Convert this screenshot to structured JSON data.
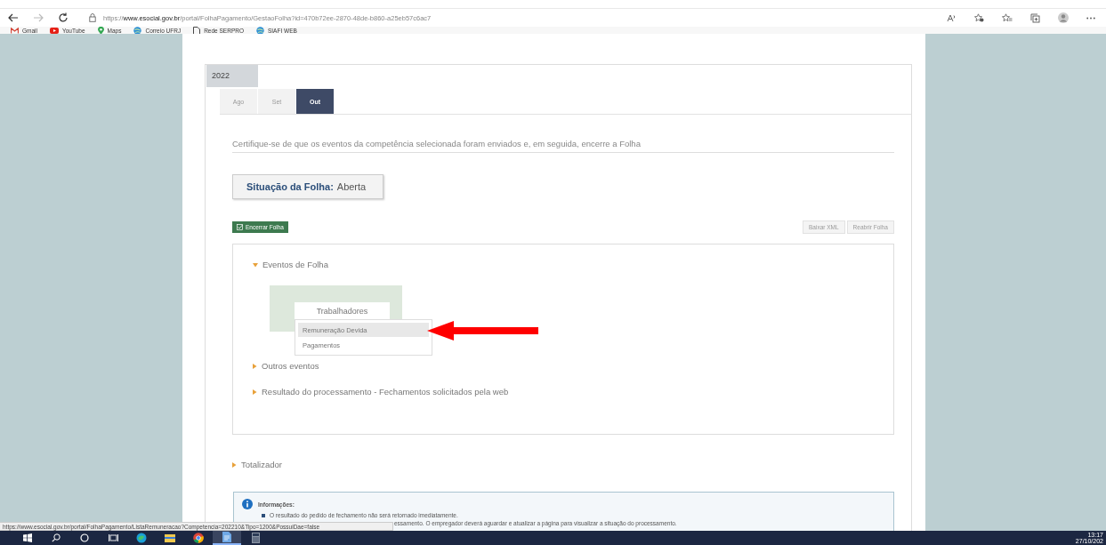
{
  "browser": {
    "url": {
      "scheme": "https://",
      "host": "www.esocial.gov.br",
      "path": "/portal/FolhaPagamento/GestaoFolha?id=470b72ee-2870-48de-b860-a25eb57c6ac7"
    },
    "bookmarks": [
      {
        "label": "Gmail",
        "kind": "gmail"
      },
      {
        "label": "YouTube",
        "kind": "youtube"
      },
      {
        "label": "Maps",
        "kind": "pin"
      },
      {
        "label": "Correio UFRJ",
        "kind": "globe"
      },
      {
        "label": "Rede SERPRO",
        "kind": "page"
      },
      {
        "label": "SIAFI WEB",
        "kind": "globe"
      }
    ]
  },
  "page": {
    "year": "2022",
    "months": [
      {
        "label": "Ago",
        "selected": false
      },
      {
        "label": "Set",
        "selected": false
      },
      {
        "label": "Out",
        "selected": true
      }
    ],
    "instruction": "Certifique-se de que os eventos da competência selecionada foram enviados e, em seguida, encerre a Folha",
    "status": {
      "label": "Situação da Folha:",
      "value": "Aberta"
    },
    "buttons": [
      {
        "label": "Encerrar Folha",
        "kind": "primary",
        "disabled": false
      },
      {
        "label": "Baixar XML",
        "kind": "secondary",
        "disabled": true
      },
      {
        "label": "Reabrir Folha",
        "kind": "secondary",
        "disabled": true
      }
    ],
    "sections": [
      {
        "label": "Eventos de Folha",
        "expanded": true
      },
      {
        "label": "Outros eventos",
        "expanded": false
      },
      {
        "label": "Resultado do processamento - Fechamentos solicitados pela web",
        "expanded": false
      }
    ],
    "menu": {
      "label": "Trabalhadores",
      "items": [
        {
          "label": "Remuneração Devida",
          "selected": true
        },
        {
          "label": "Pagamentos",
          "selected": false
        }
      ]
    },
    "totalizer": {
      "label": "Totalizador",
      "expanded": false
    },
    "info": {
      "title": "Informações:",
      "items": [
        "O resultado do pedido de fechamento não será retornado imediatamente.",
        "essamento. O empregador deverá aguardar e atualizar a página para visualizar a situação do processamento."
      ]
    }
  },
  "status_url": "https://www.esocial.gov.br/portal/FolhaPagamento/ListaRemuneracao?Competencia=202210&Tipo=1200&PossuiDae=false",
  "taskbar": {
    "apps": [
      {
        "kind": "start",
        "active": false
      },
      {
        "kind": "search",
        "active": false
      },
      {
        "kind": "cortana",
        "active": false
      },
      {
        "kind": "taskview",
        "active": false
      },
      {
        "kind": "edge",
        "active": false
      },
      {
        "kind": "explorer",
        "active": false
      },
      {
        "kind": "chrome",
        "active": false
      },
      {
        "kind": "document",
        "active": true
      },
      {
        "kind": "calculator",
        "active": false
      }
    ],
    "time": "13:17",
    "date": "27/10/202"
  }
}
